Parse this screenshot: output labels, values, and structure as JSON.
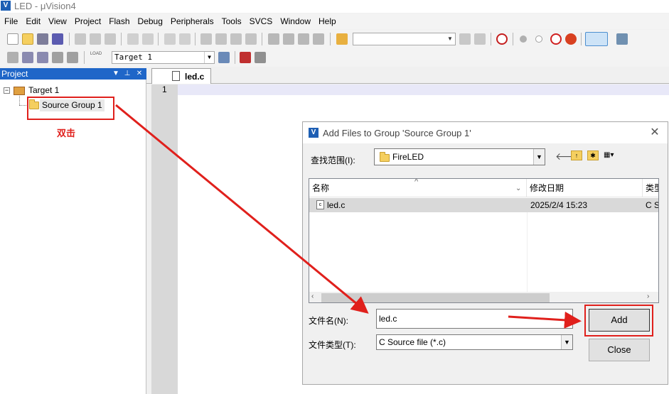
{
  "window": {
    "title": "LED  - μVision4",
    "icon_letter": "V"
  },
  "menu": [
    "File",
    "Edit",
    "View",
    "Project",
    "Flash",
    "Debug",
    "Peripherals",
    "Tools",
    "SVCS",
    "Window",
    "Help"
  ],
  "toolbar2": {
    "target_value": "Target 1",
    "load_label": "LOAD"
  },
  "project_pane": {
    "header": "Project",
    "tree": {
      "root": "Target 1",
      "group": "Source Group 1"
    }
  },
  "annotation": {
    "double_click": "双击"
  },
  "editor": {
    "tab_label": "led.c",
    "line_number": "1"
  },
  "dialog": {
    "title": "Add Files to Group 'Source Group 1'",
    "look_in_label": "查找范围(I):",
    "look_in_value": "FireLED",
    "columns": {
      "name": "名称",
      "date": "修改日期",
      "type": "类型"
    },
    "files": [
      {
        "name": "led.c",
        "date": "2025/2/4 15:23",
        "type": "C S"
      }
    ],
    "filename_label": "文件名(N):",
    "filename_value": "led.c",
    "filetype_label": "文件类型(T):",
    "filetype_value": "C Source file (*.c)",
    "add_button": "Add",
    "close_button": "Close"
  },
  "colors": {
    "accent_red": "#e0201c",
    "pane_header": "#1f66c8"
  }
}
